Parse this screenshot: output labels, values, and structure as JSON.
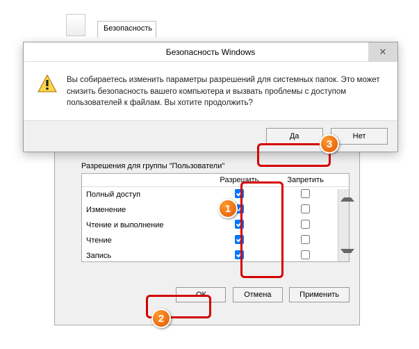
{
  "bg": {
    "tab_security": "Безопасность"
  },
  "warn": {
    "title": "Безопасность Windows",
    "close_glyph": "✕",
    "message": "Вы собираетесь изменить параметры разрешений для системных папок. Это может снизить безопасность вашего компьютера и вызвать проблемы с доступом пользователей к файлам. Вы хотите продолжить?",
    "yes": "Да",
    "no": "Нет"
  },
  "perm": {
    "group_label": "Разрешения для группы \"Пользователи\"",
    "col_allow": "Разрешить",
    "col_deny": "Запретить",
    "rows": [
      {
        "name": "Полный доступ",
        "allow": true,
        "deny": false
      },
      {
        "name": "Изменение",
        "allow": true,
        "deny": false
      },
      {
        "name": "Чтение и выполнение",
        "allow": true,
        "deny": false
      },
      {
        "name": "Чтение",
        "allow": true,
        "deny": false
      },
      {
        "name": "Запись",
        "allow": true,
        "deny": false
      }
    ],
    "ok": "ОК",
    "cancel": "Отмена",
    "apply": "Применить"
  },
  "annot": {
    "n1": "1",
    "n2": "2",
    "n3": "3"
  }
}
